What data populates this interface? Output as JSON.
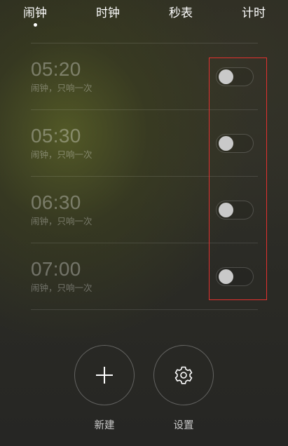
{
  "tabs": [
    {
      "label": "闹钟",
      "active": true
    },
    {
      "label": "时钟",
      "active": false
    },
    {
      "label": "秒表",
      "active": false
    },
    {
      "label": "计时",
      "active": false
    }
  ],
  "alarms": [
    {
      "time": "05:20",
      "repeat": "闹钟，只响一次",
      "enabled": false
    },
    {
      "time": "05:30",
      "repeat": "闹钟，只响一次",
      "enabled": false
    },
    {
      "time": "06:30",
      "repeat": "闹钟，只响一次",
      "enabled": false
    },
    {
      "time": "07:00",
      "repeat": "闹钟，只响一次",
      "enabled": false
    }
  ],
  "actions": {
    "new_label": "新建",
    "settings_label": "设置"
  },
  "icons": {
    "new": "plus-icon",
    "settings": "gear-icon"
  },
  "colors": {
    "highlight_box": "#e3312f",
    "toggle_knob": "#c9c9c9"
  }
}
